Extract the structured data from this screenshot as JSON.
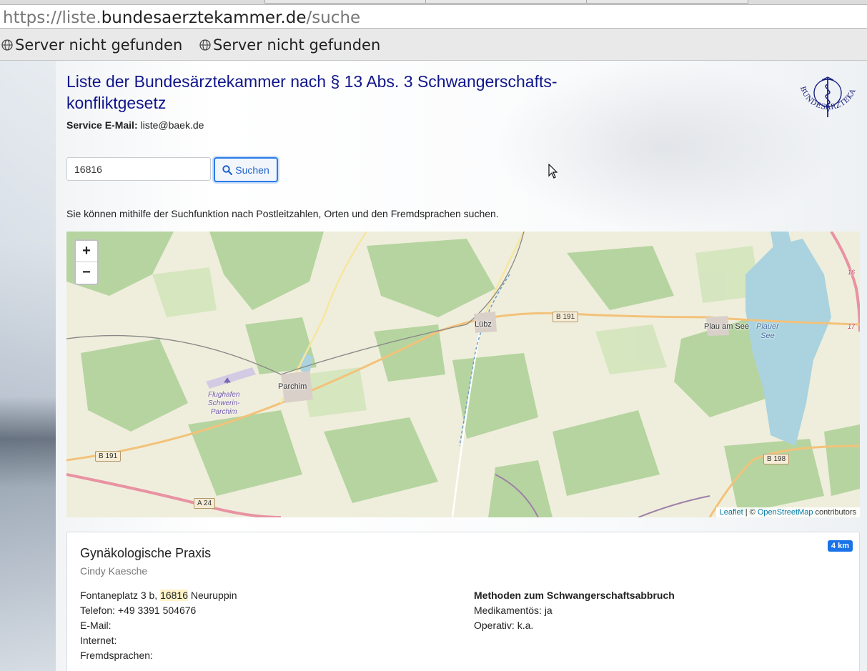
{
  "browser": {
    "url_prefix": "https://liste.",
    "url_host": "bundesaerztekammer.de",
    "url_path": "/suche",
    "bookmarks": [
      {
        "icon": "globe-icon",
        "label": "Server nicht gefunden"
      },
      {
        "icon": "globe-icon",
        "label": "Server nicht gefunden"
      }
    ]
  },
  "header": {
    "title": "Liste der Bundesärztekammer nach § 13 Abs. 3 Schwangerschafts-konfliktgesetz",
    "service_label": "Service E-Mail:",
    "service_email": "liste@baek.de",
    "logo_text": "BUNDESÄRZTEKAMMER"
  },
  "search": {
    "value": "16816",
    "button_label": "Suchen",
    "hint": "Sie können mithilfe der Suchfunktion nach Postleitzahlen, Orten und den Fremdsprachen suchen."
  },
  "map": {
    "zoom_in": "+",
    "zoom_out": "−",
    "places": [
      "Lübz",
      "Plau am See",
      "Parchim"
    ],
    "water": [
      "Plauer",
      "See"
    ],
    "airport": [
      "Flughafen",
      "Schwerin-",
      "Parchim"
    ],
    "roads": [
      "B 191",
      "B 191",
      "B 198",
      "A 24",
      "16",
      "17"
    ],
    "attribution": {
      "leaflet": "Leaflet",
      "sep": " | © ",
      "osm": "OpenStreetMap",
      "suffix": " contributors"
    }
  },
  "result": {
    "distance": "4 km",
    "name": "Gynäkologische Praxis",
    "person": "Cindy Kaesche",
    "address_street": "Fontaneplatz 3 b, ",
    "address_zip": "16816",
    "address_city": " Neuruppin",
    "phone": "Telefon: +49 3391 504676",
    "email_label": "E-Mail:",
    "internet_label": "Internet:",
    "languages_label": "Fremdsprachen:",
    "methods_title": "Methoden zum Schwangerschaftsabbruch",
    "method_medical": "Medikamentös: ja",
    "method_surgical": "Operativ: k.a."
  }
}
